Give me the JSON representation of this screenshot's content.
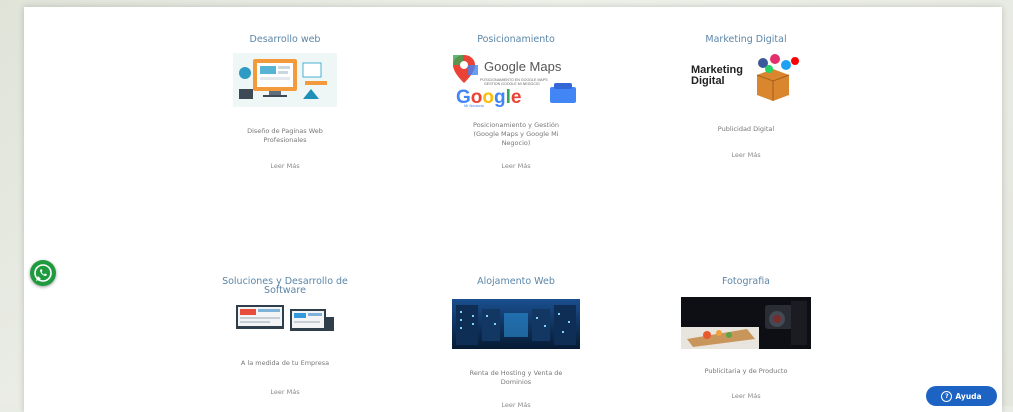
{
  "colors": {
    "title": "#5b86a8",
    "whatsapp": "#1f9a3f",
    "help_button": "#1d63c4"
  },
  "services": [
    {
      "title": "Desarrollo web",
      "description": "Diseño de Paginas Web Profesionales",
      "link": "Leer Más",
      "icon": "web-development-illustration"
    },
    {
      "title": "Posicionamiento",
      "description": "Posicionamiento y Gestión (Google Maps y Google Mi Negocio)",
      "link": "Leer Más",
      "image_text": {
        "maps": "Google Maps",
        "small": "POSICIONAMIENTO EN GOOGLE MAPS GESTION GOOGLE MI NEGOCIO",
        "google": "Google",
        "mi_negocio": "Mi Negocio"
      }
    },
    {
      "title": "Marketing Digital",
      "description": "Publicidad Digital",
      "link": "Leer Más",
      "image_text": {
        "line1": "Marketing",
        "line2": "Digital"
      }
    },
    {
      "title": "Soluciones y Desarrollo de Software",
      "description": "A la medida de tu Empresa",
      "link": "Leer Más",
      "icon": "software-screens-illustration"
    },
    {
      "title": "Alojamento Web",
      "description": "Renta de Hosting y Venta de Dominios",
      "link": "Leer Más",
      "icon": "server-room-photo"
    },
    {
      "title": "Fotografia",
      "description": "Publicitaria y de Producto",
      "link": "Leer Más",
      "icon": "food-photography-photo"
    }
  ],
  "help_button": {
    "label": "Ayuda",
    "icon_char": "?"
  }
}
